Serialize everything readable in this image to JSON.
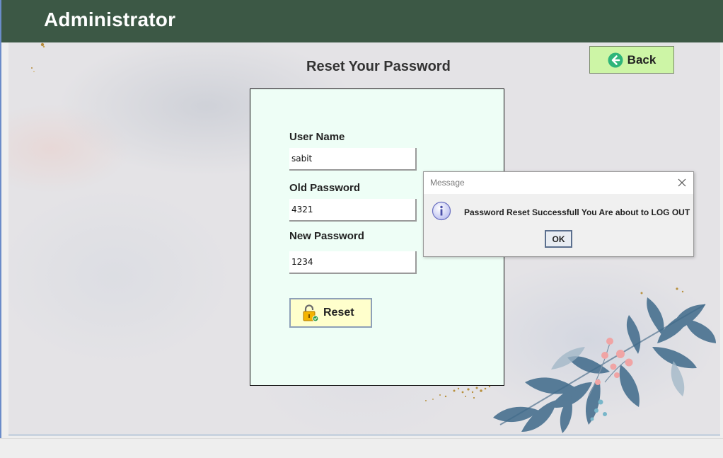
{
  "header": {
    "title": "Administrator"
  },
  "page": {
    "title": "Reset Your Password"
  },
  "back_button": {
    "label": "Back",
    "icon": "arrow-left-circle-icon",
    "color": "#cdf5a6"
  },
  "form": {
    "username_label": "User Name",
    "username_value": "sabit",
    "old_password_label": "Old Password",
    "old_password_value": "4321",
    "new_password_label": "New Password",
    "new_password_value": "1234",
    "reset_label": "Reset",
    "reset_icon": "lock-icon"
  },
  "dialog": {
    "title": "Message",
    "message": "Password Reset Successfull You Are about to LOG OUT",
    "ok_label": "OK",
    "icon": "info-icon"
  },
  "colors": {
    "header_bg": "#3c5845",
    "card_bg": "#eefef6",
    "reset_bg": "#ffffcc"
  }
}
